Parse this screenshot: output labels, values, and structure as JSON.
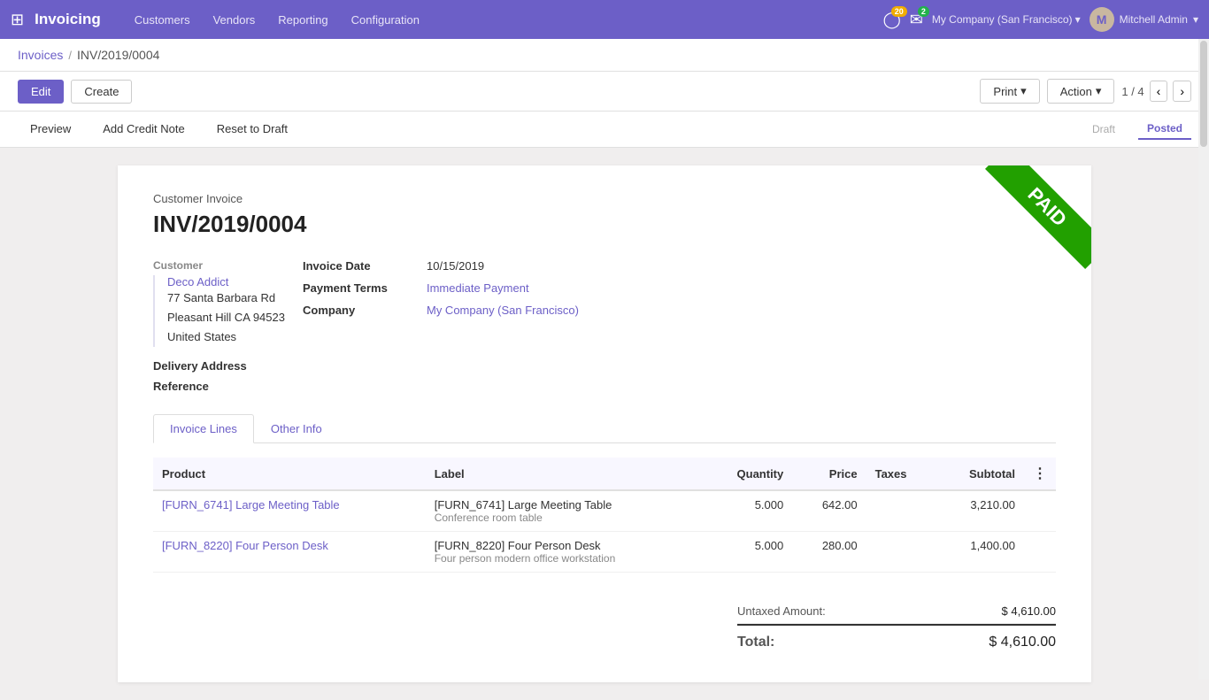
{
  "app": {
    "title": "Invoicing",
    "grid_icon": "⊞"
  },
  "nav": {
    "menu_items": [
      "Customers",
      "Vendors",
      "Reporting",
      "Configuration"
    ],
    "notifications_count": "20",
    "messages_count": "2",
    "company": "My Company (San Francisco)",
    "user": "Mitchell Admin",
    "user_avatar_initials": "M"
  },
  "breadcrumb": {
    "parent": "Invoices",
    "separator": "/",
    "current": "INV/2019/0004"
  },
  "toolbar": {
    "edit_label": "Edit",
    "create_label": "Create",
    "print_label": "Print",
    "action_label": "Action",
    "pagination": "1 / 4"
  },
  "status_buttons": {
    "preview_label": "Preview",
    "add_credit_note_label": "Add Credit Note",
    "reset_to_draft_label": "Reset to Draft",
    "statuses": [
      "Draft",
      "Posted"
    ]
  },
  "invoice": {
    "type": "Customer Invoice",
    "number": "INV/2019/0004",
    "paid_stamp": "PAID",
    "customer_label": "Customer",
    "customer_name": "Deco Addict",
    "customer_address_line1": "77 Santa Barbara Rd",
    "customer_address_line2": "Pleasant Hill CA 94523",
    "customer_address_line3": "United States",
    "delivery_address_label": "Delivery Address",
    "reference_label": "Reference",
    "invoice_date_label": "Invoice Date",
    "invoice_date": "10/15/2019",
    "payment_terms_label": "Payment Terms",
    "payment_terms": "Immediate Payment",
    "company_label": "Company",
    "company": "My Company (San Francisco)"
  },
  "tabs": {
    "invoice_lines_label": "Invoice Lines",
    "other_info_label": "Other Info"
  },
  "table": {
    "columns": [
      "Product",
      "Label",
      "Quantity",
      "Price",
      "Taxes",
      "Subtotal"
    ],
    "rows": [
      {
        "product": "[FURN_6741] Large Meeting Table",
        "label_line1": "[FURN_6741] Large Meeting Table",
        "label_line2": "Conference room table",
        "quantity": "5.000",
        "price": "642.00",
        "taxes": "",
        "subtotal": "3,210.00"
      },
      {
        "product": "[FURN_8220] Four Person Desk",
        "label_line1": "[FURN_8220] Four Person Desk",
        "label_line2": "Four person modern office workstation",
        "quantity": "5.000",
        "price": "280.00",
        "taxes": "",
        "subtotal": "1,400.00"
      }
    ]
  },
  "totals": {
    "untaxed_amount_label": "Untaxed Amount:",
    "untaxed_amount": "$ 4,610.00",
    "total_label": "Total:",
    "total": "$ 4,610.00"
  }
}
